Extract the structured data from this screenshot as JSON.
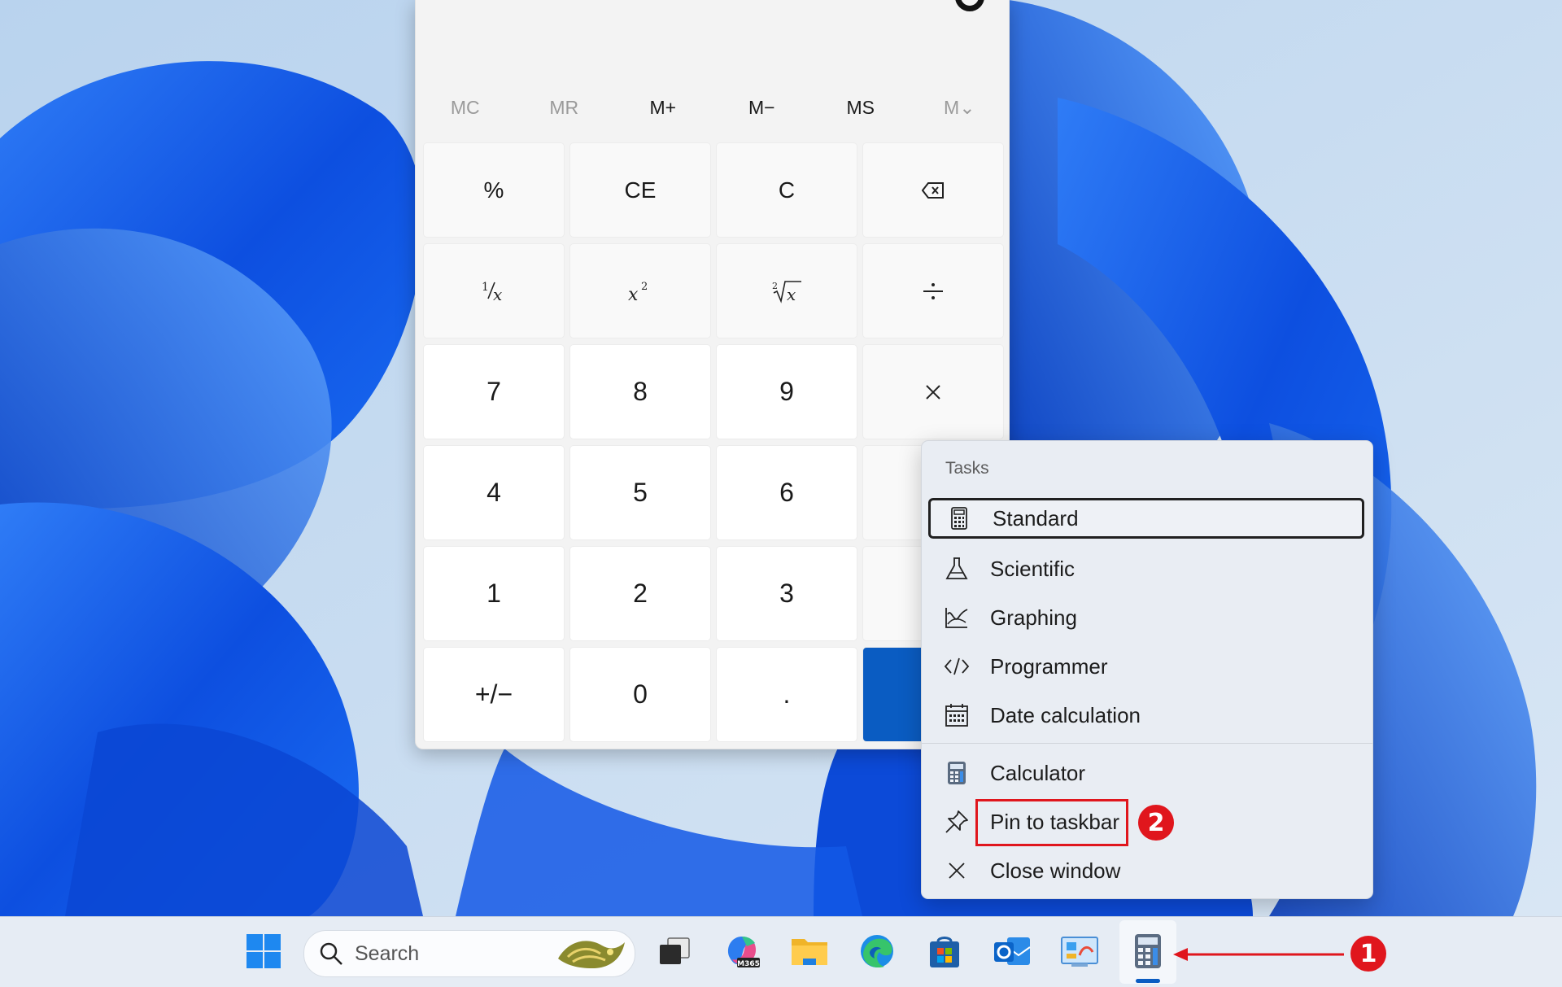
{
  "calculator": {
    "memory_buttons": [
      {
        "label": "MC",
        "enabled": false
      },
      {
        "label": "MR",
        "enabled": false
      },
      {
        "label": "M+",
        "enabled": true
      },
      {
        "label": "M−",
        "enabled": true
      },
      {
        "label": "MS",
        "enabled": true
      },
      {
        "label": "M⌄",
        "enabled": false
      }
    ],
    "keys": {
      "percent": "%",
      "clear_entry": "CE",
      "clear": "C",
      "seven": "7",
      "eight": "8",
      "nine": "9",
      "four": "4",
      "five": "5",
      "six": "6",
      "one": "1",
      "two": "2",
      "three": "3",
      "zero": "0",
      "decimal": ".",
      "negate": "+/−"
    },
    "icons": [
      "backspace-icon",
      "reciprocal-icon",
      "square-icon",
      "square-root-icon",
      "divide-icon",
      "multiply-icon"
    ]
  },
  "jump_list": {
    "header": "Tasks",
    "tasks": [
      {
        "label": "Standard",
        "icon": "calculator-standard-icon",
        "selected": true
      },
      {
        "label": "Scientific",
        "icon": "flask-icon"
      },
      {
        "label": "Graphing",
        "icon": "graph-icon"
      },
      {
        "label": "Programmer",
        "icon": "code-icon"
      },
      {
        "label": "Date calculation",
        "icon": "calendar-icon"
      }
    ],
    "app_items": [
      {
        "label": "Calculator",
        "icon": "calculator-app-icon"
      },
      {
        "label": "Pin to taskbar",
        "icon": "pin-icon"
      },
      {
        "label": "Close window",
        "icon": "close-icon"
      }
    ]
  },
  "annotations": {
    "callout_1": "1",
    "callout_2": "2",
    "color": "#e0161d"
  },
  "taskbar": {
    "search_placeholder": "Search",
    "apps": [
      "start-icon",
      "task-view-icon",
      "microsoft-365-copilot-icon",
      "file-explorer-icon",
      "edge-icon",
      "microsoft-store-icon",
      "outlook-icon",
      "control-panel-icon",
      "calculator-icon"
    ],
    "m365_badge": "M365",
    "accent": "#0a5cc2"
  }
}
